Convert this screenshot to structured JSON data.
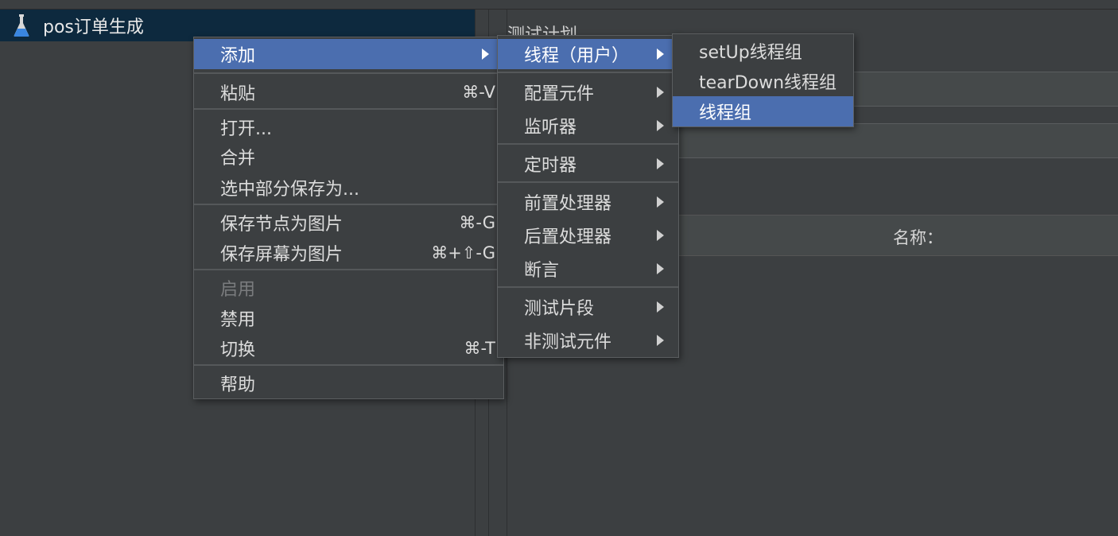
{
  "tree": {
    "root_label": "pos订单生成"
  },
  "right_panel": {
    "title": "测试计划",
    "name_column": "名称："
  },
  "context_menu": {
    "add": "添加",
    "paste": "粘贴",
    "paste_shortcut": "⌘-V",
    "open": "打开...",
    "merge": "合并",
    "save_selection": "选中部分保存为...",
    "save_node_image": "保存节点为图片",
    "save_node_image_shortcut": "⌘-G",
    "save_screen_image": "保存屏幕为图片",
    "save_screen_image_shortcut": "⌘+⇧-G",
    "enable": "启用",
    "disable": "禁用",
    "toggle": "切换",
    "toggle_shortcut": "⌘-T",
    "help": "帮助"
  },
  "add_submenu": {
    "threads": "线程（用户）",
    "config": "配置元件",
    "listener": "监听器",
    "timer": "定时器",
    "preprocessor": "前置处理器",
    "postprocessor": "后置处理器",
    "assertion": "断言",
    "test_fragment": "测试片段",
    "non_test": "非测试元件"
  },
  "threads_submenu": {
    "setup": "setUp线程组",
    "teardown": "tearDown线程组",
    "thread_group": "线程组"
  },
  "colors": {
    "selection": "#4b6eaf",
    "tree_selection": "#0d293e",
    "background": "#3c3f41"
  }
}
